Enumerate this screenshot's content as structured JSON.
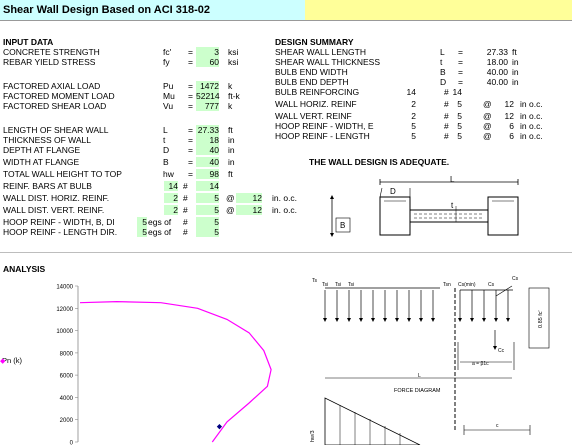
{
  "title": "Shear Wall Design Based on ACI 318-02",
  "input": {
    "header": "INPUT DATA",
    "rows": [
      {
        "label": "CONCRETE STRENGTH",
        "sym": "fc'",
        "eq": "=",
        "val": "3",
        "unit": "ksi"
      },
      {
        "label": "REBAR YIELD STRESS",
        "sym": "fy",
        "eq": "=",
        "val": "60",
        "unit": "ksi"
      },
      {
        "label": "FACTORED AXIAL LOAD",
        "sym": "Pu",
        "eq": "=",
        "val": "1472",
        "unit": "k"
      },
      {
        "label": "FACTORED MOMENT LOAD",
        "sym": "Mu",
        "eq": "=",
        "val": "52214",
        "unit": "ft-k"
      },
      {
        "label": "FACTORED SHEAR LOAD",
        "sym": "Vu",
        "eq": "=",
        "val": "777",
        "unit": "k"
      },
      {
        "label": "LENGTH OF SHEAR WALL",
        "sym": "L",
        "eq": "=",
        "val": "27.33",
        "unit": "ft"
      },
      {
        "label": "THICKNESS OF  WALL",
        "sym": "t",
        "eq": "=",
        "val": "18",
        "unit": "in"
      },
      {
        "label": "DEPTH AT FLANGE",
        "sym": "D",
        "eq": "=",
        "val": "40",
        "unit": "in"
      },
      {
        "label": "WIDTH AT FLANGE",
        "sym": "B",
        "eq": "=",
        "val": "40",
        "unit": "in"
      },
      {
        "label": "TOTAL WALL HEIGHT TO TOP",
        "sym": "hw",
        "eq": "=",
        "val": "98",
        "unit": "ft"
      }
    ],
    "reinf": [
      {
        "label": "REINF.  BARS AT BULB",
        "a": "14",
        "hash": "#",
        "b": "14",
        "at": "",
        "c": "",
        "tail": ""
      },
      {
        "label": "WALL DIST. HORIZ. REINF.",
        "a": "2",
        "hash": "#",
        "b": "5",
        "at": "@",
        "c": "12",
        "tail": "in. o.c."
      },
      {
        "label": "WALL DIST. VERT. REINF.",
        "a": "2",
        "hash": "#",
        "b": "5",
        "at": "@",
        "c": "12",
        "tail": "in. o.c."
      },
      {
        "label": "HOOP REINF - WIDTH, B, DI",
        "a": "5",
        "mid": "egs of",
        "hash": "#",
        "b": "5",
        "at": "",
        "c": "",
        "tail": ""
      },
      {
        "label": "HOOP REINF - LENGTH DIR.",
        "a": "5",
        "mid": "egs of",
        "hash": "#",
        "b": "5",
        "at": "",
        "c": "",
        "tail": ""
      }
    ]
  },
  "summary": {
    "header": "DESIGN SUMMARY",
    "rows": [
      {
        "label": "SHEAR WALL LENGTH",
        "sym": "L",
        "eq": "=",
        "val": "27.33",
        "unit": "ft"
      },
      {
        "label": "SHEAR WALL THICKNESS",
        "sym": "t",
        "eq": "=",
        "val": "18.00",
        "unit": "in"
      },
      {
        "label": "BULB END WIDTH",
        "sym": "B",
        "eq": "=",
        "val": "40.00",
        "unit": "in"
      },
      {
        "label": "BULB END DEPTH",
        "sym": "D",
        "eq": "=",
        "val": "40.00",
        "unit": "in"
      }
    ],
    "reinf": [
      {
        "label": "BULB REINFORCING",
        "a": "14",
        "hash": "#",
        "b": "14",
        "at": "",
        "c": "",
        "tail": ""
      },
      {
        "label": "WALL HORIZ. REINF",
        "a": "2",
        "hash": "#",
        "b": "5",
        "at": "@",
        "c": "12",
        "tail": "in o.c."
      },
      {
        "label": "WALL VERT. REINF",
        "a": "2",
        "hash": "#",
        "b": "5",
        "at": "@",
        "c": "12",
        "tail": "in o.c."
      },
      {
        "label": "HOOP REINF - WIDTH, E",
        "a": "5",
        "hash": "#",
        "b": "5",
        "at": "@",
        "c": "6",
        "tail": "in o.c."
      },
      {
        "label": "HOOP REINF - LENGTH",
        "a": "5",
        "hash": "#",
        "b": "5",
        "at": "@",
        "c": "6",
        "tail": "in o.c."
      }
    ],
    "verdict": "THE WALL DESIGN IS ADEQUATE."
  },
  "section_fig": {
    "L": "L",
    "D": "D",
    "t": "t",
    "B": "B"
  },
  "analysis": {
    "header": "ANALYSIS",
    "ylabel": "Pn (k)",
    "yticks": [
      "14000",
      "12000",
      "10000",
      "8000",
      "6000",
      "4000",
      "2000",
      "0"
    ],
    "marker_symbol": "◆"
  },
  "force_diagram": {
    "title": "FORCE DIAGRAM",
    "labels": [
      "Ts",
      "Tsi",
      "Tsi",
      "Tsi",
      "Tsn",
      "Cs(min)",
      "Cs",
      "Cs",
      "Cc",
      "a = β1c",
      "L",
      "0.85 fc'",
      "hw/3",
      "c"
    ]
  },
  "chart_data": {
    "type": "line",
    "title": "",
    "xlabel": "",
    "ylabel": "Pn (k)",
    "ylim": [
      0,
      14000
    ],
    "yticks": [
      0,
      2000,
      4000,
      6000,
      8000,
      10000,
      12000,
      14000
    ],
    "series": [
      {
        "x": [
          0,
          0.1,
          0.22,
          0.32,
          0.4,
          0.46,
          0.5,
          0.52,
          0.51,
          0.46,
          0.4,
          0.36
        ],
        "values": [
          12500,
          12600,
          12500,
          12000,
          11000,
          9800,
          8200,
          6500,
          5000,
          3500,
          1800,
          0
        ]
      },
      {
        "x": [
          0.38
        ],
        "values": [
          1500
        ]
      }
    ],
    "grid": false
  }
}
